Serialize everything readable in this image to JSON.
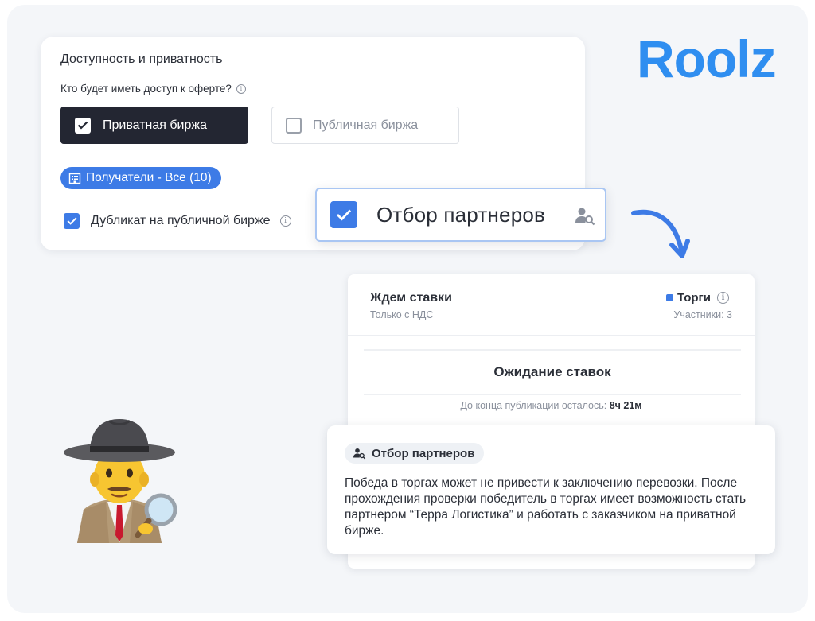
{
  "logo": {
    "text": "Roolz"
  },
  "access_card": {
    "title": "Доступность и приватность",
    "question": "Кто будет иметь доступ к оферте?",
    "private_label": "Приватная биржа",
    "public_label": "Публичная биржа",
    "recipients_label": "Получатели - Все (10)",
    "duplicate_label": "Дубликат на публичной бирже"
  },
  "partner_chip": {
    "label": "Отбор партнеров"
  },
  "bids_card": {
    "title": "Ждем ставки",
    "subtitle": "Только с НДС",
    "status": "Торги",
    "participants": "Участники: 3",
    "waiting": "Ожидание ставок",
    "remaining_prefix": "До конца публикации осталось:",
    "remaining_value": "8ч 21м"
  },
  "desc_card": {
    "tag": "Отбор партнеров",
    "text": "Победа в торгах может не привести к заключению перевозки. После прохождения проверки победитель в торгах имеет возможность стать партнером “Терра Логистика” и работать с заказчиком на приватной бирже."
  },
  "colors": {
    "accent": "#3d7be6",
    "dark": "#232632",
    "logo": "#2f8ef0"
  }
}
